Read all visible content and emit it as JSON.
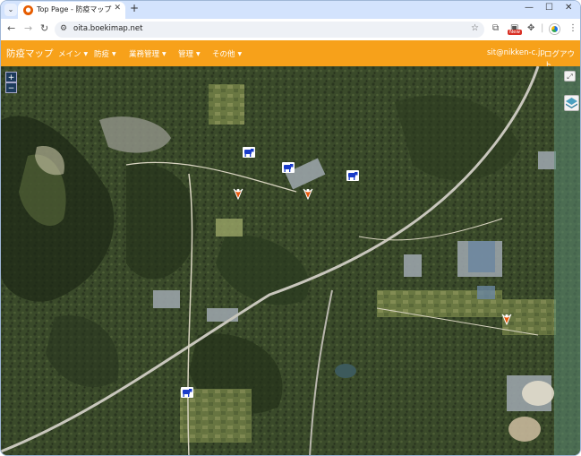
{
  "browser": {
    "tab_title": "Top Page - 防疫マップ",
    "url": "oita.boekimap.net",
    "new_badge": "New"
  },
  "app": {
    "brand": "防疫マップ",
    "menus": [
      {
        "label": "メイン"
      },
      {
        "label": "防疫"
      },
      {
        "label": "業務管理"
      },
      {
        "label": "管理"
      },
      {
        "label": "その他"
      }
    ],
    "user_email": "sit@nikken-c.jp",
    "logout_label": "ログアウト"
  },
  "map": {
    "zoom_in": "+",
    "zoom_out": "−",
    "markers": [
      {
        "type": "cow",
        "color": "#1a3cc9"
      },
      {
        "type": "cow",
        "color": "#1a3cc9"
      },
      {
        "type": "cow",
        "color": "#1a3cc9"
      },
      {
        "type": "cow",
        "color": "#1a3cc9"
      },
      {
        "type": "chicken",
        "color": "#e8590c"
      },
      {
        "type": "chicken",
        "color": "#e8590c"
      },
      {
        "type": "chicken",
        "color": "#e8590c"
      }
    ]
  }
}
